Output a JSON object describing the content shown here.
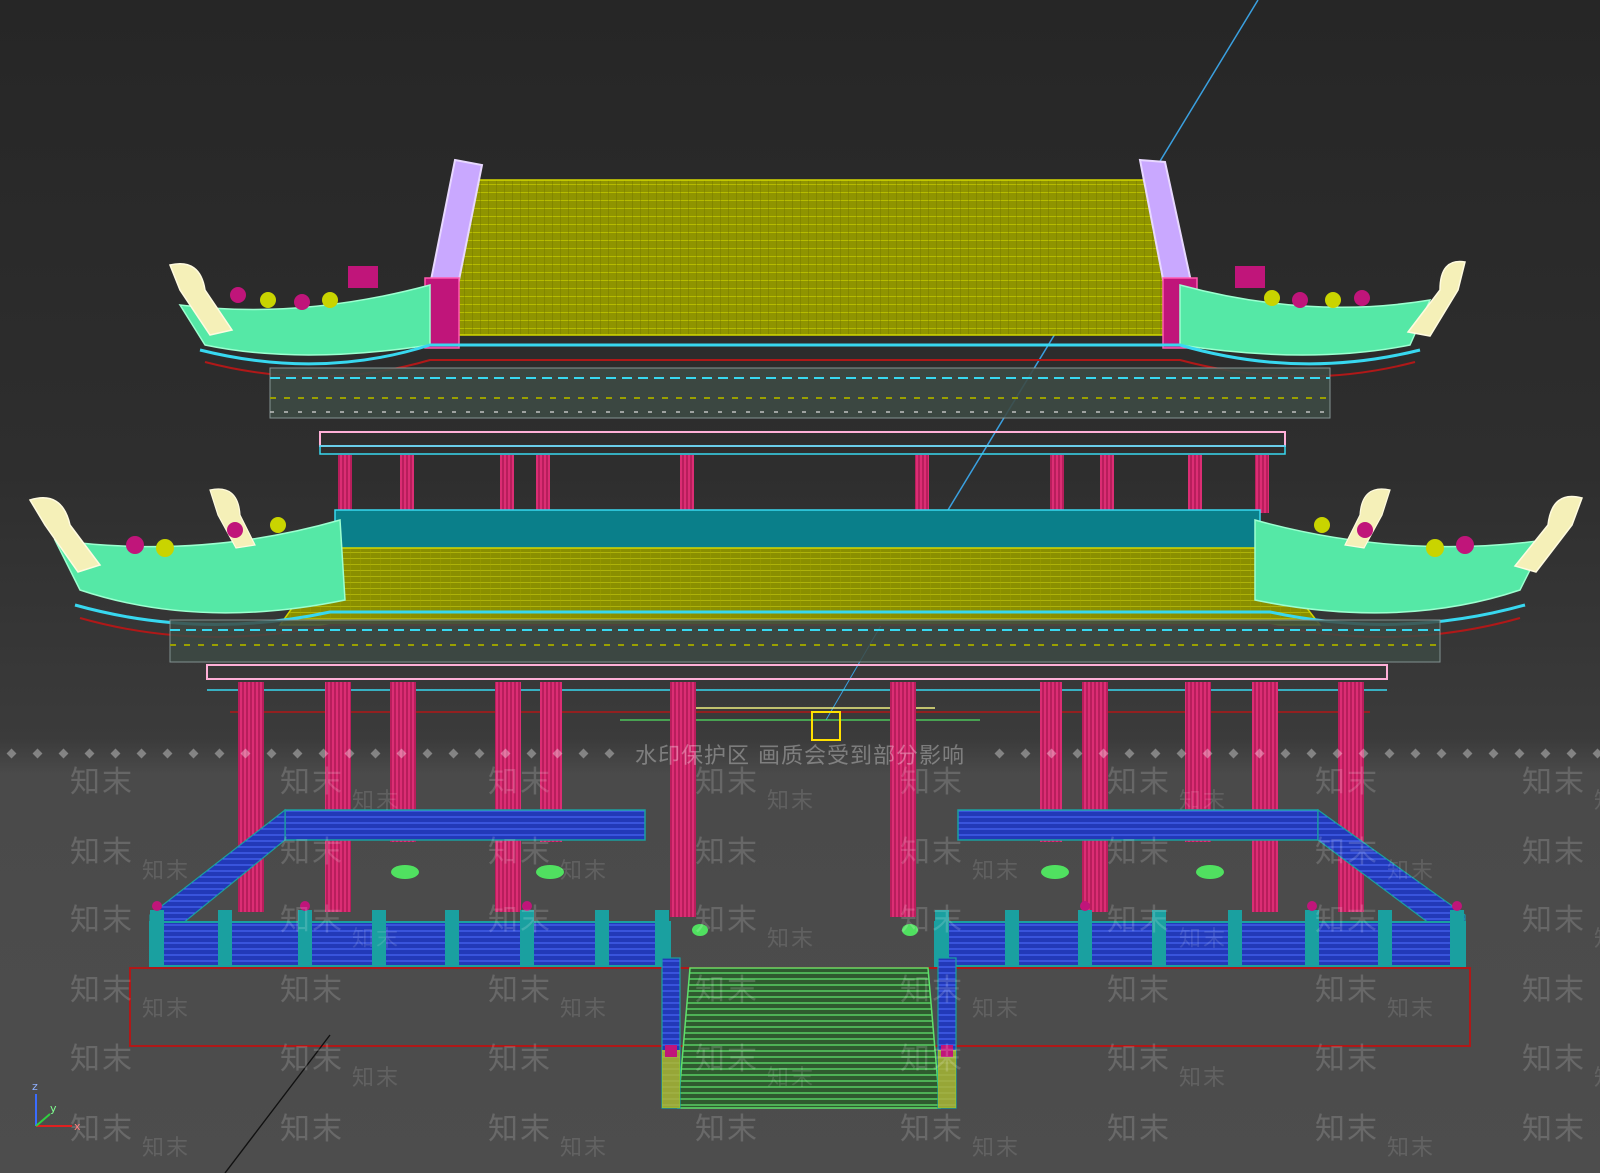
{
  "watermark": {
    "notice": "水印保护区  画质会受到部分影响",
    "brand": "知末"
  },
  "viewport": {
    "axis": {
      "x": "x",
      "y": "y",
      "z": "z"
    },
    "colors": {
      "roof": "#9aa000",
      "roof_line": "#c8cc00",
      "cyan_band": "#0a7f8a",
      "mint": "#55e8a6",
      "column": "#e0256e",
      "railing_blue": "#2b4ad8",
      "railing_teal": "#1aa0a0",
      "lavender": "#c9a8ff",
      "magenta": "#c0157a",
      "cream": "#f5f0b8",
      "base_red": "#b01818",
      "stair_green": "#50e060",
      "ray_blue": "#3aa0e0"
    }
  }
}
